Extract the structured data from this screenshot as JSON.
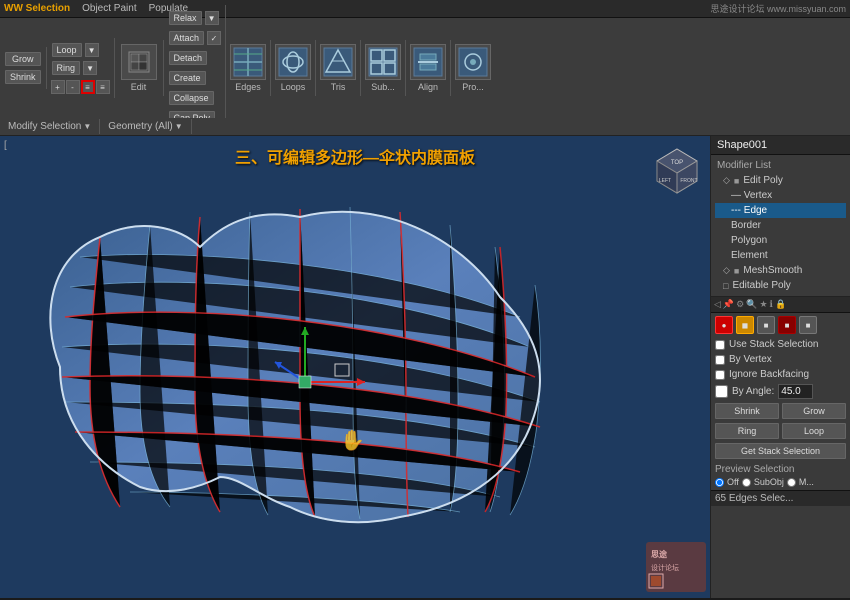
{
  "topbar": {
    "left": "WW Selection",
    "middle": "Object Paint",
    "populate": "Populate",
    "right": "思途设计论坛 www.missyuan.com"
  },
  "toolbar": {
    "grow_label": "Grow",
    "shrink_label": "Shrink",
    "loop_label": "Loop",
    "ring_label": "Ring",
    "edit_label": "Edit",
    "relax_label": "Relax",
    "attach_label": "Attach",
    "detach_label": "Detach",
    "create_label": "Create",
    "collapse_label": "Collapse",
    "cap_poly_label": "Cap Poly",
    "edges_label": "Edges",
    "loops_label": "Loops",
    "tris_label": "Tris",
    "sub_label": "Sub...",
    "align_label": "Align",
    "pro_label": "Pro..."
  },
  "section_labels": {
    "modify_selection": "Modify Selection",
    "geometry_all": "Geometry (All)"
  },
  "viewport": {
    "bracket_label": "[",
    "text_overlay": "三、可编辑多边形—伞状内膜面板"
  },
  "right_panel": {
    "shape_name": "Shape001",
    "modifier_list_label": "Modifier List",
    "modifiers": [
      {
        "id": "edit_poly",
        "label": "Edit Poly",
        "level": 0,
        "active": false
      },
      {
        "id": "vertex",
        "label": "Vertex",
        "level": 1,
        "active": false
      },
      {
        "id": "edge",
        "label": "Edge",
        "level": 1,
        "active": true
      },
      {
        "id": "border",
        "label": "Border",
        "level": 1,
        "active": false
      },
      {
        "id": "polygon",
        "label": "Polygon",
        "level": 1,
        "active": false
      },
      {
        "id": "element",
        "label": "Element",
        "level": 1,
        "active": false
      },
      {
        "id": "mesh_smooth",
        "label": "MeshSmooth",
        "level": 0,
        "active": false
      },
      {
        "id": "editable_poly",
        "label": "Editable Poly",
        "level": 0,
        "active": false
      }
    ],
    "use_stack_selection": "Use Stack Selection",
    "by_vertex": "By Vertex",
    "ignore_backfacing": "Ignore Backfacing",
    "by_angle": "By Angle:",
    "angle_value": "45.0",
    "shrink_btn": "Shrink",
    "grow_btn": "Grow",
    "ring_btn": "Ring",
    "loop_btn": "Loop",
    "get_stack_selection": "Get Stack Selection",
    "preview_selection": "Preview Selection",
    "off_label": "Off",
    "subobj_label": "SubObj",
    "m_label": "M...",
    "status_text": "65 Edges Selec..."
  }
}
